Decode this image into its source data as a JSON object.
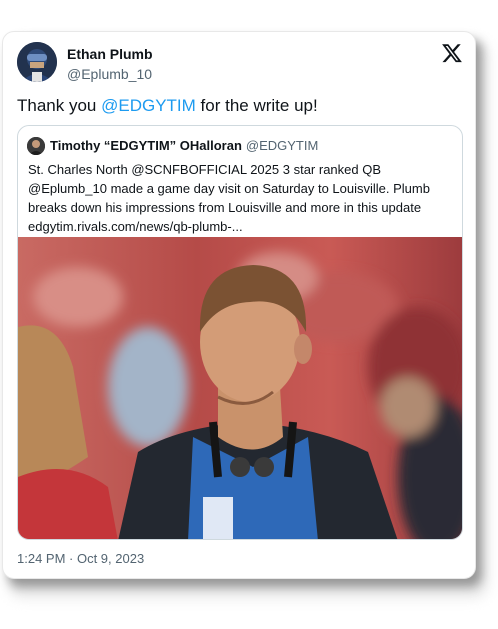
{
  "tweet": {
    "author_name": "Ethan Plumb",
    "author_handle": "@Eplumb_10",
    "text_prefix": "Thank you ",
    "mention": "@EDGYTIM",
    "text_suffix": " for the write up!",
    "timestamp": "1:24 PM · Oct 9, 2023"
  },
  "quoted_tweet": {
    "author_name": "Timothy “EDGYTIM” OHalloran",
    "author_handle": "@EDGYTIM",
    "text": "St. Charles North @SCNFBOFFICIAL 2025 3 star ranked QB @Eplumb_10 made a game day visit on Saturday to Louisville. Plumb breaks down his impressions from Louisville and more in this update",
    "link": "edgytim.rivals.com/news/qb-plumb-..."
  },
  "icons": {
    "platform": "x-logo-icon"
  },
  "colors": {
    "mention": "#1d9bf0",
    "secondary_text": "#536471",
    "border": "#cfd9de"
  }
}
